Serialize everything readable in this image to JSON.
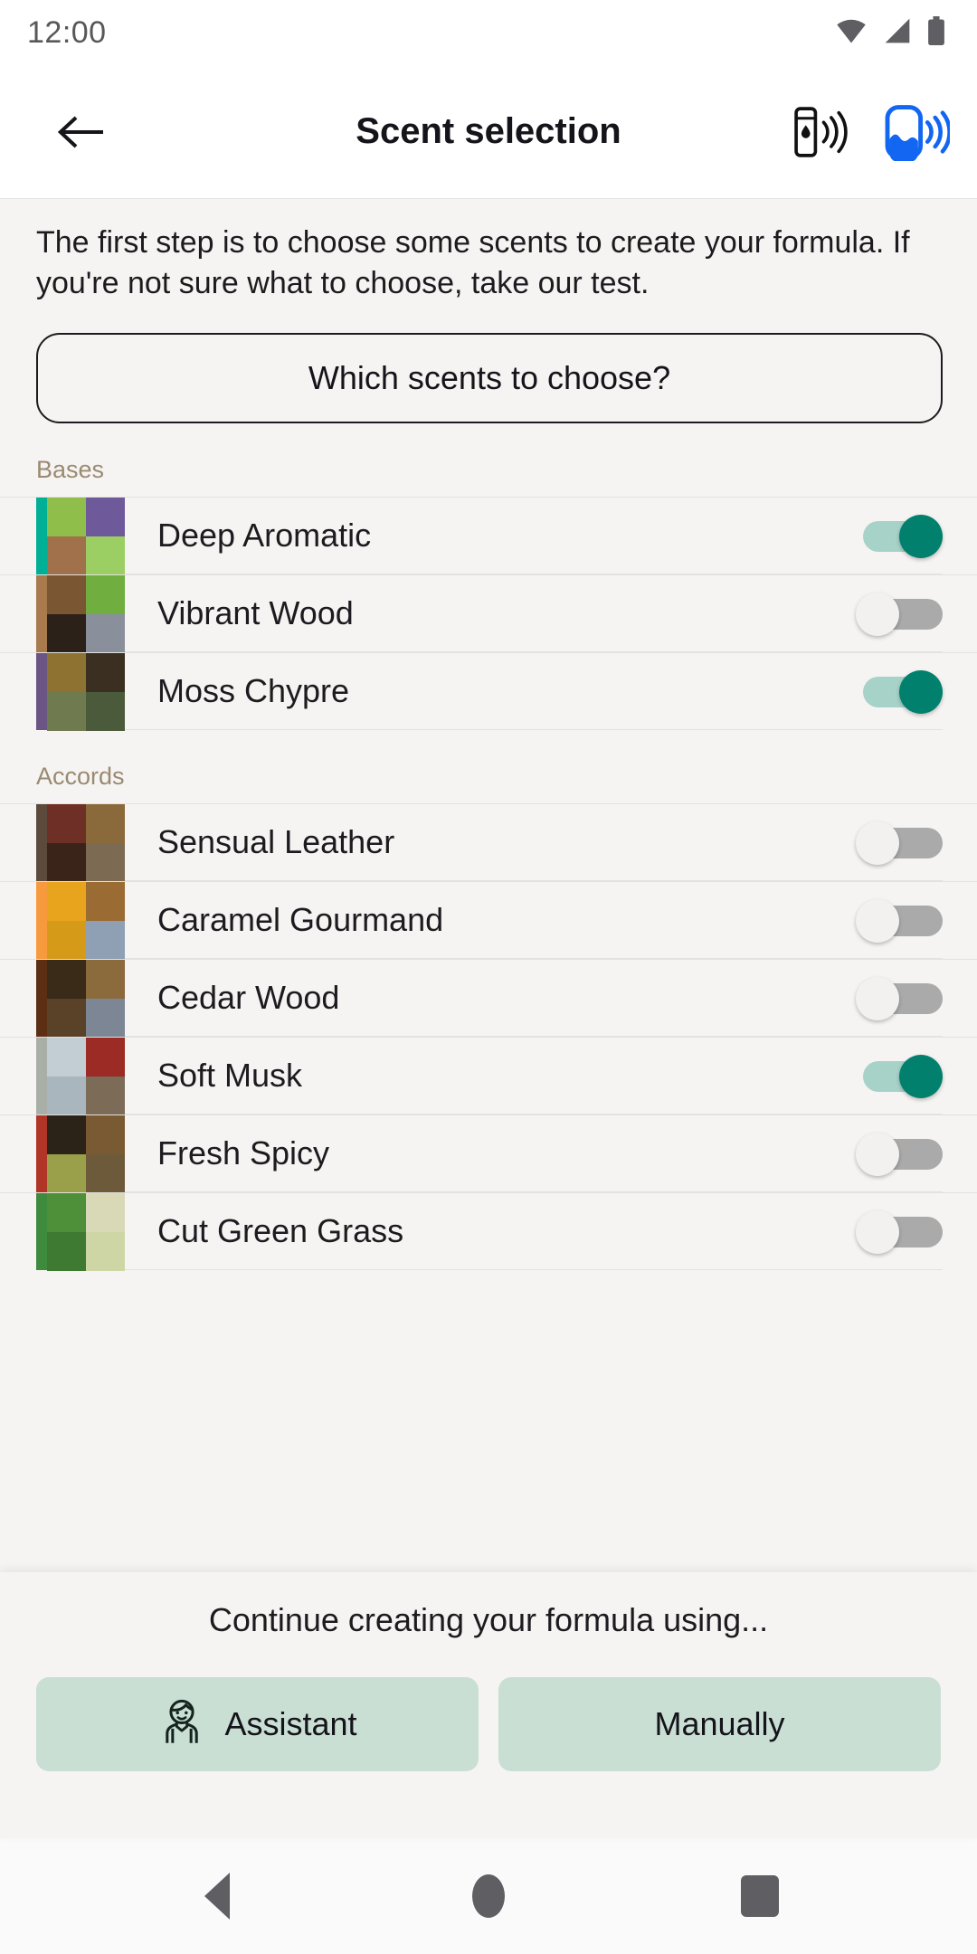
{
  "status_bar": {
    "time": "12:00",
    "icons": [
      "wifi-icon",
      "cellular-signal-icon",
      "battery-icon"
    ]
  },
  "app_bar": {
    "back_icon": "arrow-left-icon",
    "title": "Scent selection",
    "actions": [
      {
        "name": "device-dispenser-icon",
        "label": "Dispenser connection",
        "color": "#111111"
      },
      {
        "name": "device-cartridge-icon",
        "label": "Cartridge connection",
        "color": "#1266F1"
      }
    ]
  },
  "main": {
    "intro": "The first step is to choose some scents to create your formula. If you're not sure what to choose, take our test.",
    "cta_label": "Which scents to choose?",
    "sections": [
      {
        "label": "Bases",
        "items": [
          {
            "name": "Deep Aromatic",
            "on": true,
            "accent": "#00b096",
            "swatch": [
              "#8fbe4a",
              "#6e5a9b",
              "#a0714a",
              "#9ccf63"
            ]
          },
          {
            "name": "Vibrant Wood",
            "on": false,
            "accent": "#a87a4e",
            "swatch": [
              "#7a5632",
              "#6fae3f",
              "#2b2118",
              "#8a8f9c"
            ]
          },
          {
            "name": "Moss Chypre",
            "on": true,
            "accent": "#6b5585",
            "swatch": [
              "#8e7232",
              "#3b2f22",
              "#6f7a4e",
              "#4b5a3a"
            ]
          }
        ]
      },
      {
        "label": "Accords",
        "items": [
          {
            "name": "Sensual Leather",
            "on": false,
            "accent": "#5c4a3d",
            "swatch": [
              "#6e3026",
              "#8a6a3a",
              "#3a2318",
              "#7d6a52"
            ]
          },
          {
            "name": "Caramel Gourmand",
            "on": false,
            "accent": "#f79a3e",
            "swatch": [
              "#e7a41c",
              "#9a6c34",
              "#d59b18",
              "#8fa0b4"
            ]
          },
          {
            "name": "Cedar Wood",
            "on": false,
            "accent": "#5c2e14",
            "swatch": [
              "#3a2a18",
              "#8b6a3c",
              "#5a4228",
              "#7d8694"
            ]
          },
          {
            "name": "Soft Musk",
            "on": true,
            "accent": "#a9aea6",
            "swatch": [
              "#c2cdd4",
              "#9b2b24",
              "#a9b6bd",
              "#7b6b57"
            ]
          },
          {
            "name": "Fresh Spicy",
            "on": false,
            "accent": "#b03526",
            "swatch": [
              "#2b2318",
              "#7a5a32",
              "#9aa04a",
              "#6d5a3a"
            ]
          },
          {
            "name": "Cut Green Grass",
            "on": false,
            "accent": "#3e8b3e",
            "swatch": [
              "#4e8f3a",
              "#d9d9b8",
              "#3f7a32",
              "#cfd6a6"
            ]
          }
        ]
      }
    ]
  },
  "bottom_sheet": {
    "title": "Continue creating your formula using...",
    "buttons": [
      {
        "label": "Assistant",
        "icon": "assistant-person-icon"
      },
      {
        "label": "Manually",
        "icon": null
      }
    ]
  },
  "nav_bar": {
    "back": "nav-back-icon",
    "home": "nav-home-icon",
    "recents": "nav-recents-icon"
  }
}
